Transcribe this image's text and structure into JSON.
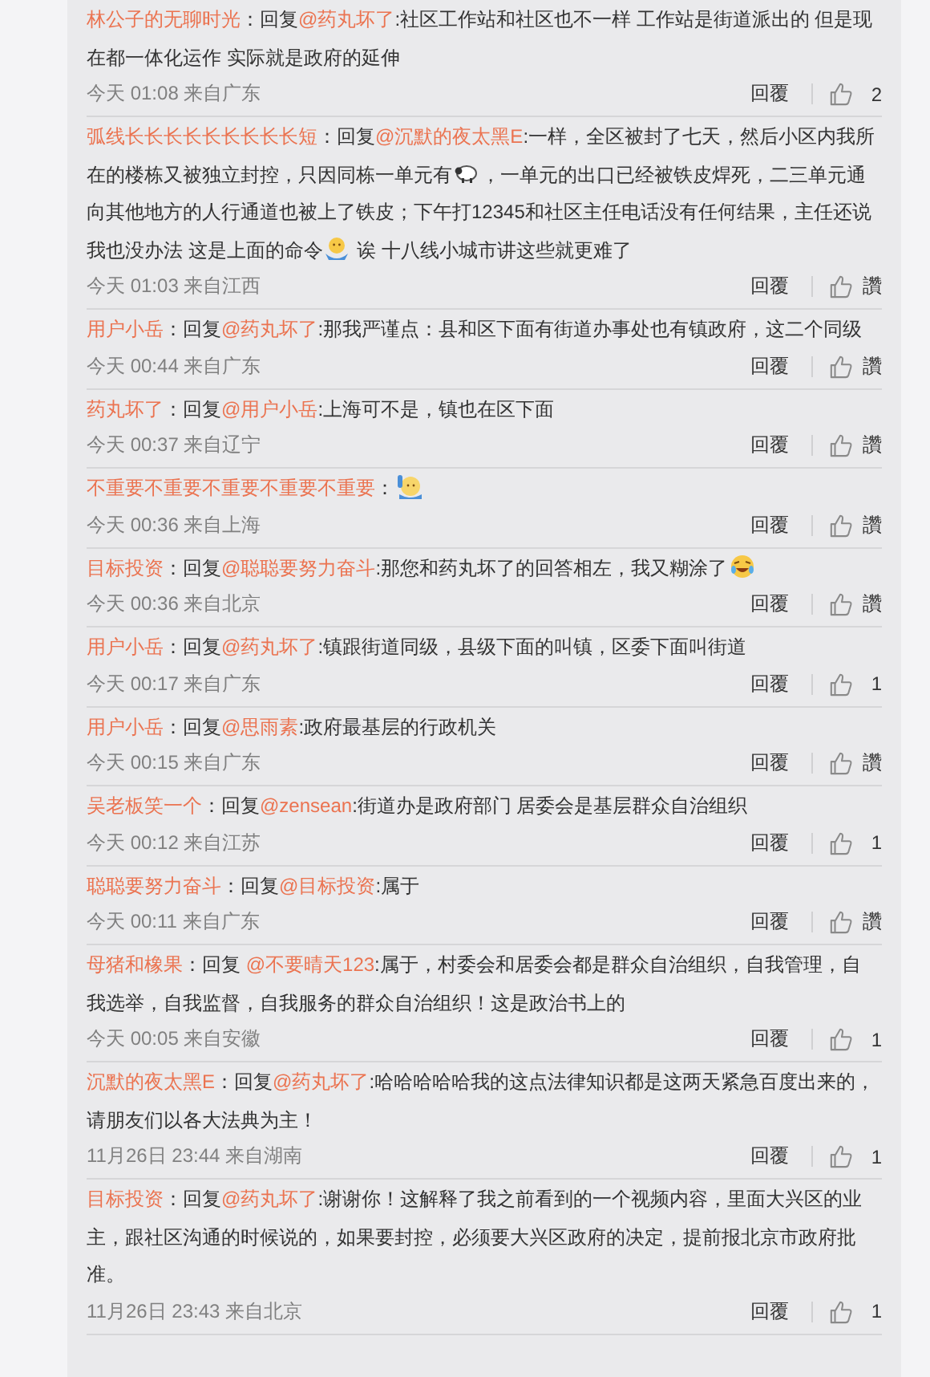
{
  "comments": [
    {
      "author": "林公子的无聊时光",
      "reply_word": "：回复",
      "mention": "@药丸坏了",
      "body": [
        {
          "kind": "text",
          "text": ":社区工作站和社区也不一样 工作站是街道派出的 但是现在都一体化运作 实际就是政府的延伸"
        }
      ],
      "meta": "今天 01:08 来自广东",
      "reply_label": "回覆",
      "like_label": "2"
    },
    {
      "author": "弧线长长长长长长长长长短",
      "reply_word": "：回复",
      "mention": "@沉默的夜太黑E",
      "body": [
        {
          "kind": "text",
          "text": ":一样，全区被封了七天，然后小区内我所在的楼栋又被独立封控，只因同栋一单元有"
        },
        {
          "kind": "sheep"
        },
        {
          "kind": "text",
          "text": "，一单元的出口已经被铁皮焊死，二三单元通向其他地方的人行通道也被上了铁皮；下午打12345和社区主任电话没有任何结果，主任还说我也没办法 这是上面的命令"
        },
        {
          "kind": "shrug"
        },
        {
          "kind": "text",
          "text": " 诶 十八线小城市讲这些就更难了"
        }
      ],
      "meta": "今天 01:03 来自江西",
      "reply_label": "回覆",
      "like_label": "讚"
    },
    {
      "author": "用户小岳",
      "reply_word": "：回复",
      "mention": "@药丸坏了",
      "body": [
        {
          "kind": "text",
          "text": ":那我严谨点：县和区下面有街道办事处也有镇政府，这二个同级"
        }
      ],
      "meta": "今天 00:44 来自广东",
      "reply_label": "回覆",
      "like_label": "讚"
    },
    {
      "author": "药丸坏了",
      "reply_word": "：回复",
      "mention": "@用户小岳",
      "body": [
        {
          "kind": "text",
          "text": ":上海可不是，镇也在区下面"
        }
      ],
      "meta": "今天 00:37 来自辽宁",
      "reply_label": "回覆",
      "like_label": "讚"
    },
    {
      "author": "不重要不重要不重要不重要不重要",
      "reply_word": "：",
      "body": [
        {
          "kind": "wave"
        }
      ],
      "meta": "今天 00:36 来自上海",
      "reply_label": "回覆",
      "like_label": "讚"
    },
    {
      "author": "目标投资",
      "reply_word": "：回复",
      "mention": "@聪聪要努力奋斗",
      "body": [
        {
          "kind": "text",
          "text": ":那您和药丸坏了的回答相左，我又糊涂了"
        },
        {
          "kind": "laugh"
        }
      ],
      "meta": "今天 00:36 来自北京",
      "reply_label": "回覆",
      "like_label": "讚"
    },
    {
      "author": "用户小岳",
      "reply_word": "：回复",
      "mention": "@药丸坏了",
      "body": [
        {
          "kind": "text",
          "text": ":镇跟街道同级，县级下面的叫镇，区委下面叫街道"
        }
      ],
      "meta": "今天 00:17 来自广东",
      "reply_label": "回覆",
      "like_label": "1"
    },
    {
      "author": "用户小岳",
      "reply_word": "：回复",
      "mention": "@思雨素",
      "body": [
        {
          "kind": "text",
          "text": ":政府最基层的行政机关"
        }
      ],
      "meta": "今天 00:15 来自广东",
      "reply_label": "回覆",
      "like_label": "讚"
    },
    {
      "author": "吴老板笑一个",
      "reply_word": "：回复",
      "mention": "@zensean",
      "body": [
        {
          "kind": "text",
          "text": ":街道办是政府部门 居委会是基层群众自治组织"
        }
      ],
      "meta": "今天 00:12 来自江苏",
      "reply_label": "回覆",
      "like_label": "1"
    },
    {
      "author": "聪聪要努力奋斗",
      "reply_word": "：回复",
      "mention": "@目标投资",
      "body": [
        {
          "kind": "text",
          "text": ":属于"
        }
      ],
      "meta": "今天 00:11 来自广东",
      "reply_label": "回覆",
      "like_label": "讚"
    },
    {
      "author": "母猪和橡果",
      "reply_word": "：回复 ",
      "mention": "@不要晴天123",
      "body": [
        {
          "kind": "text",
          "text": ":属于，村委会和居委会都是群众自治组织，自我管理，自我选举，自我监督，自我服务的群众自治组织！这是政治书上的"
        }
      ],
      "meta": "今天 00:05 来自安徽",
      "reply_label": "回覆",
      "like_label": "1"
    },
    {
      "author": "沉默的夜太黑E",
      "reply_word": "：回复",
      "mention": "@药丸坏了",
      "body": [
        {
          "kind": "text",
          "text": ":哈哈哈哈哈我的这点法律知识都是这两天紧急百度出来的，请朋友们以各大法典为主！"
        }
      ],
      "meta": "11月26日 23:44 来自湖南",
      "reply_label": "回覆",
      "like_label": "1"
    },
    {
      "author": "目标投资",
      "reply_word": "：回复",
      "mention": "@药丸坏了",
      "body": [
        {
          "kind": "text",
          "text": ":谢谢你！这解释了我之前看到的一个视频内容，里面大兴区的业主，跟社区沟通的时候说的，如果要封控，必须要大兴区政府的决定，提前报北京市政府批准。"
        }
      ],
      "meta": "11月26日 23:43 来自北京",
      "reply_label": "回覆",
      "like_label": "1"
    }
  ]
}
